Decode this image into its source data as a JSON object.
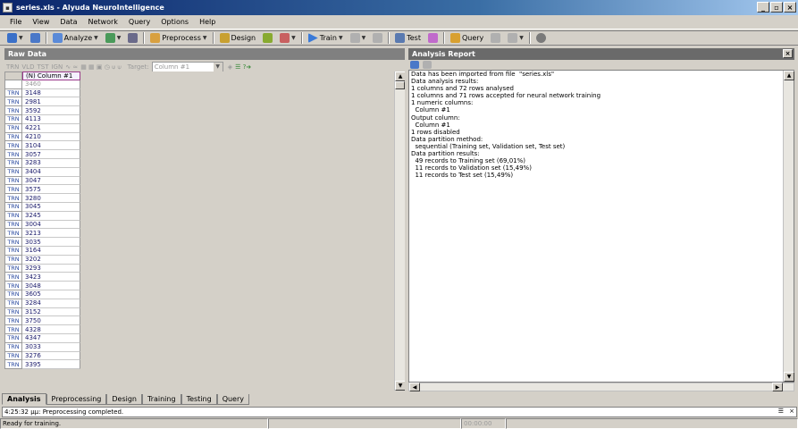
{
  "window": {
    "title": "series.xls - Alyuda NeuroIntelligence"
  },
  "menu": [
    "File",
    "View",
    "Data",
    "Network",
    "Query",
    "Options",
    "Help"
  ],
  "toolbar": {
    "analyze_label": "Analyze",
    "preprocess_label": "Preprocess",
    "design_label": "Design",
    "train_label": "Train",
    "test_label": "Test",
    "query_label": "Query"
  },
  "raw_data": {
    "header": "Raw Data",
    "tool_labels": [
      "TRN",
      "VLD",
      "TST",
      "IGN"
    ],
    "target_label": "Target:",
    "target_value": "Column #1",
    "column_header": "(N) Column #1",
    "first_value": "3460",
    "rows": [
      {
        "tag": "TRN",
        "value": "3148"
      },
      {
        "tag": "TRN",
        "value": "2981"
      },
      {
        "tag": "TRN",
        "value": "3592"
      },
      {
        "tag": "TRN",
        "value": "4113"
      },
      {
        "tag": "TRN",
        "value": "4221"
      },
      {
        "tag": "TRN",
        "value": "4210"
      },
      {
        "tag": "TRN",
        "value": "3104"
      },
      {
        "tag": "TRN",
        "value": "3057"
      },
      {
        "tag": "TRN",
        "value": "3283"
      },
      {
        "tag": "TRN",
        "value": "3404"
      },
      {
        "tag": "TRN",
        "value": "3047"
      },
      {
        "tag": "TRN",
        "value": "3575"
      },
      {
        "tag": "TRN",
        "value": "3280"
      },
      {
        "tag": "TRN",
        "value": "3045"
      },
      {
        "tag": "TRN",
        "value": "3245"
      },
      {
        "tag": "TRN",
        "value": "3004"
      },
      {
        "tag": "TRN",
        "value": "3213"
      },
      {
        "tag": "TRN",
        "value": "3035"
      },
      {
        "tag": "TRN",
        "value": "3164"
      },
      {
        "tag": "TRN",
        "value": "3202"
      },
      {
        "tag": "TRN",
        "value": "3293"
      },
      {
        "tag": "TRN",
        "value": "3423"
      },
      {
        "tag": "TRN",
        "value": "3048"
      },
      {
        "tag": "TRN",
        "value": "3605"
      },
      {
        "tag": "TRN",
        "value": "3284"
      },
      {
        "tag": "TRN",
        "value": "3152"
      },
      {
        "tag": "TRN",
        "value": "3750"
      },
      {
        "tag": "TRN",
        "value": "4328"
      },
      {
        "tag": "TRN",
        "value": "4347"
      },
      {
        "tag": "TRN",
        "value": "3033"
      },
      {
        "tag": "TRN",
        "value": "3276"
      },
      {
        "tag": "TRN",
        "value": "3395"
      }
    ]
  },
  "report": {
    "header": "Analysis Report",
    "lines": [
      "Data has been imported from file  \"series.xls\"",
      "Data analysis results:",
      "1 columns and 72 rows analysed",
      "1 columns and 71 rows accepted for neural network training",
      "1 numeric columns:",
      "  Column #1",
      "Output column:",
      "  Column #1",
      "1 rows disabled",
      "Data partition method:",
      "  sequential (Training set, Validation set, Test set)",
      "Data partition results:",
      "  49 records to Training set (69,01%)",
      "  11 records to Validation set (15,49%)",
      "  11 records to Test set (15,49%)"
    ]
  },
  "tabs": [
    "Analysis",
    "Preprocessing",
    "Design",
    "Training",
    "Testing",
    "Query"
  ],
  "log": "4:25:32 μμ: Preprocessing completed.",
  "status": {
    "left": "Ready for training.",
    "timer": "00:00:00"
  }
}
